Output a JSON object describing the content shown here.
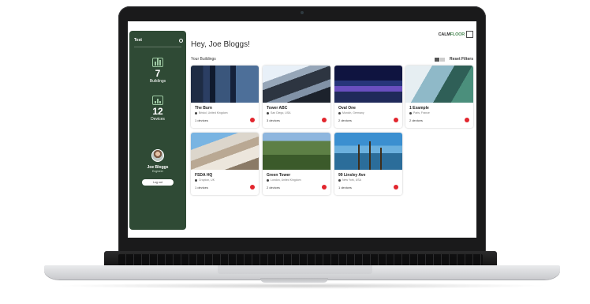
{
  "sidebar": {
    "title": "Test",
    "buildings_count": "7",
    "buildings_label": "Buildings",
    "devices_count": "12",
    "devices_label": "Devices",
    "user_name": "Joe Bloggs",
    "user_role": "Engineer",
    "logout_label": "Log out"
  },
  "header": {
    "logo_bold": "CALM",
    "logo_light": "FLOOR",
    "greeting": "Hey, Joe Bloggs!",
    "section_title": "Your Buildings",
    "reset_label": "Reset Filters"
  },
  "buildings": [
    {
      "name": "The Burn",
      "location": "Bristol, United Kingdom",
      "devices": "1 devices"
    },
    {
      "name": "Tower ABC",
      "location": "San Diego, USA",
      "devices": "3 devices"
    },
    {
      "name": "Oval One",
      "location": "Munich, Germany",
      "devices": "2 devices"
    },
    {
      "name": "1 Example",
      "location": "Paris, France",
      "devices": "2 devices"
    },
    {
      "name": "FSDA HQ",
      "location": "Croydon, UK",
      "devices": "1 devices"
    },
    {
      "name": "Green Tower",
      "location": "London, United Kingdom",
      "devices": "2 devices"
    },
    {
      "name": "99 Linsley Ave",
      "location": "New York, USA",
      "devices": "1 devices"
    }
  ],
  "colors": {
    "sidebar_bg": "#2f4a35",
    "accent_green": "#4d8c57",
    "alert_red": "#e2262e"
  },
  "icons": {
    "buildings": "buildings-icon",
    "devices": "device-icon",
    "settings": "gear-icon",
    "location": "pin-icon",
    "alert": "alert-dot-icon",
    "view_toggle": "grid-view-icon"
  }
}
